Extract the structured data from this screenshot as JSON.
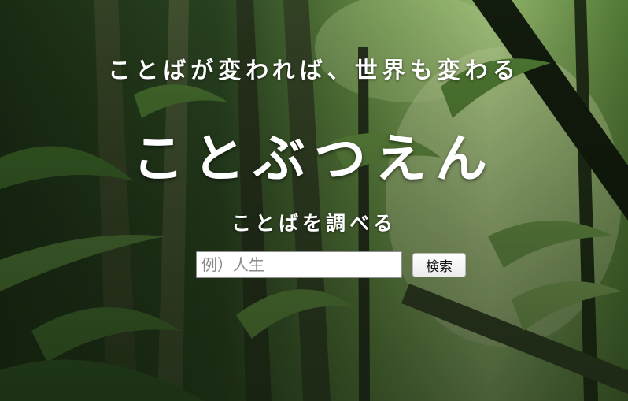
{
  "hero": {
    "tagline": "ことばが変われば、世界も変わる",
    "title": "ことぶつえん",
    "subtitle": "ことばを調べる"
  },
  "search": {
    "placeholder": "例）人生",
    "value": "",
    "button_label": "検索"
  },
  "colors": {
    "text": "#ffffff",
    "foliage_dark": "#1f3318",
    "foliage_mid": "#4f7a34",
    "foliage_light": "#b9d98a"
  }
}
